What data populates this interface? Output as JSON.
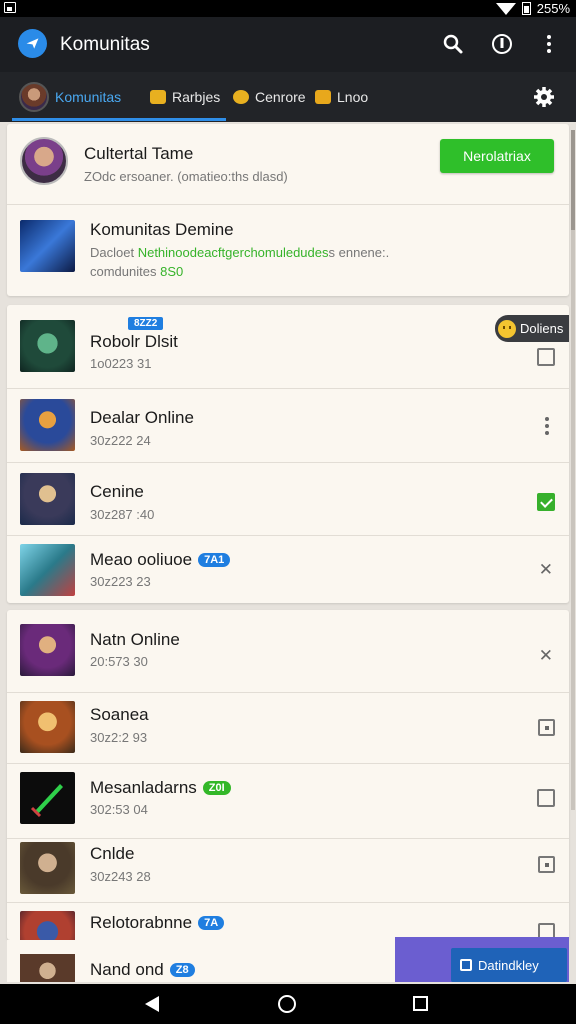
{
  "status_bar": {
    "battery_pct": "255%"
  },
  "app_bar": {
    "title": "Komunitas"
  },
  "tabs": [
    {
      "label": "Komunitas",
      "active": true,
      "icon": "avatar"
    },
    {
      "label": "Rarbjes",
      "active": false,
      "icon": "box-icon"
    },
    {
      "label": "Cenrore",
      "active": false,
      "icon": "lightning-icon"
    },
    {
      "label": "Lnoo",
      "active": false,
      "icon": "folder-icon"
    }
  ],
  "header_card": {
    "profile": {
      "title": "Cultertal Tame",
      "subtitle": "ZOdc ersoaner. (omatieo:ths dlasd)",
      "button_label": "Nerolatriax"
    },
    "community": {
      "title": "Komunitas Demine",
      "line1_prefix": "Dacloet",
      "line1_green": "Nethinoodeacftgerchomuledudes",
      "line1_suffix": "s ennene:.",
      "line2_prefix": "comdunites",
      "line2_green": "8S0"
    }
  },
  "options_chip": {
    "label": "Doliens"
  },
  "list_group_1": [
    {
      "name": "Robolr Dlsit",
      "code": "1o0223 31",
      "badge": "8ZZ2",
      "badge_color": "blue",
      "badge_above": true,
      "control": "checkbox"
    },
    {
      "name": "Dealar Online",
      "code": "30z222 24",
      "control": "kebab"
    },
    {
      "name": "Cenine",
      "code": "30z287 :40",
      "control": "checkbox-checked"
    },
    {
      "name": "Meao ooliuoe",
      "code": "30z223 23",
      "badge": "7A1",
      "badge_color": "blue",
      "control": "close"
    }
  ],
  "list_group_2": [
    {
      "name": "Natn Online",
      "code": "20:573 30",
      "control": "close"
    },
    {
      "name": "Soanea",
      "code": "30z2:2 93",
      "control": "checkbox-dot"
    },
    {
      "name": "Mesanladarns",
      "code": "302:53 04",
      "badge": "Z0I",
      "badge_color": "green",
      "control": "checkbox"
    },
    {
      "name": "Cnlde",
      "code": "30z243 28",
      "control": "checkbox-dot"
    },
    {
      "name": "Relotorabnne",
      "code": "",
      "badge": "7A",
      "badge_color": "blue",
      "control": "checkbox"
    }
  ],
  "bottom_item": {
    "name": "Nand ond",
    "badge": "Z8"
  },
  "fab": {
    "label": "Datindkley"
  },
  "colors": {
    "accent_blue": "#2f8ee8",
    "green": "#2fbf2a",
    "appbar": "#1c1e22",
    "fab_purple": "#6b5ed0"
  }
}
